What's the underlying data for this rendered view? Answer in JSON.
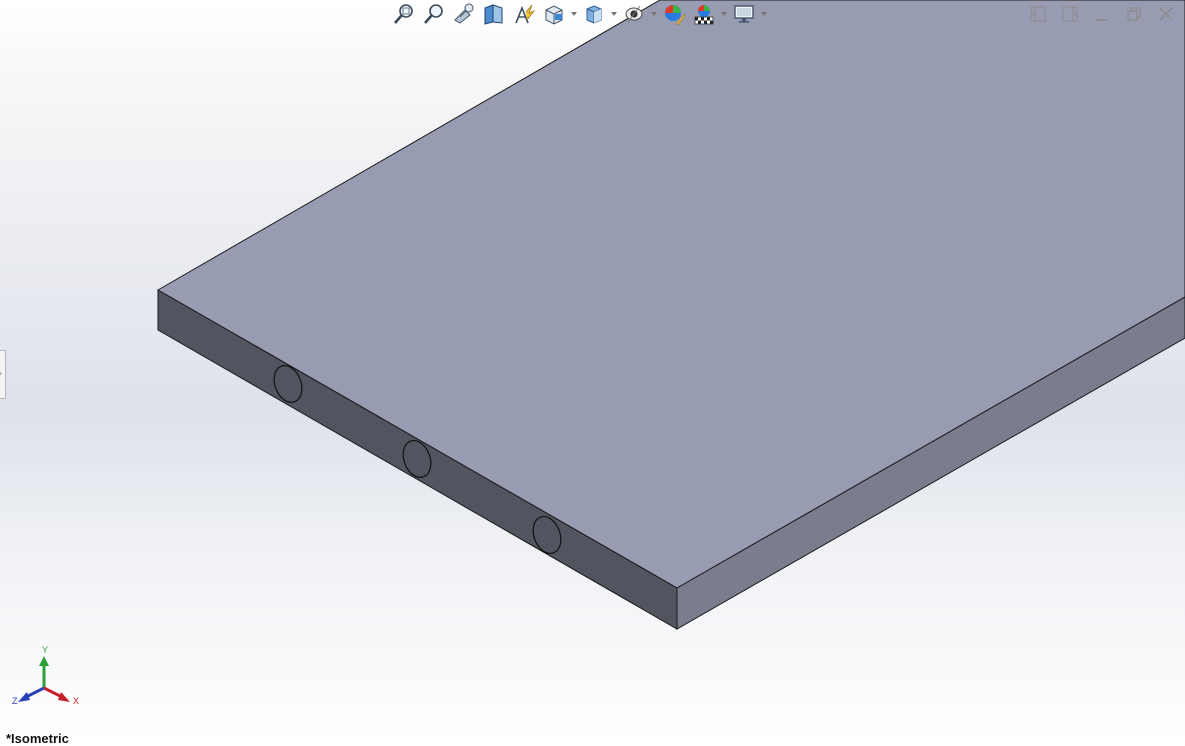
{
  "heads_up_toolbar": {
    "buttons": [
      {
        "name": "zoom-to-fit",
        "icon": "zoom-fit-icon",
        "dropdown": false
      },
      {
        "name": "zoom-to-area",
        "icon": "zoom-area-icon",
        "dropdown": false
      },
      {
        "name": "previous-view",
        "icon": "previous-view-icon",
        "dropdown": false
      },
      {
        "name": "section-view",
        "icon": "section-view-icon",
        "dropdown": false
      },
      {
        "name": "dynamic-annotation-views",
        "icon": "annotation-view-icon",
        "dropdown": false
      },
      {
        "name": "view-orientation",
        "icon": "view-orientation-icon",
        "dropdown": true
      },
      {
        "name": "display-style",
        "icon": "display-style-icon",
        "dropdown": true
      },
      {
        "name": "hide-show-items",
        "icon": "eye-icon",
        "dropdown": true
      },
      {
        "name": "edit-appearance",
        "icon": "appearance-icon",
        "dropdown": false
      },
      {
        "name": "apply-scene",
        "icon": "scene-icon",
        "dropdown": true
      },
      {
        "name": "view-settings",
        "icon": "monitor-icon",
        "dropdown": true
      }
    ]
  },
  "window_controls": [
    "split-left-icon",
    "split-right-icon",
    "minimize-icon",
    "restore-icon",
    "close-icon"
  ],
  "triad": {
    "x_label": "X",
    "y_label": "Y",
    "z_label": "Z",
    "x_color": "#c8202a",
    "y_color": "#2e9e36",
    "z_color": "#2b3fb8"
  },
  "view": {
    "label": "*Isometric"
  },
  "model": {
    "top_color": "#989cb2",
    "front_color": "#52545f",
    "side_color": "#7b7d8e",
    "edge_color": "#1a1a1a"
  }
}
